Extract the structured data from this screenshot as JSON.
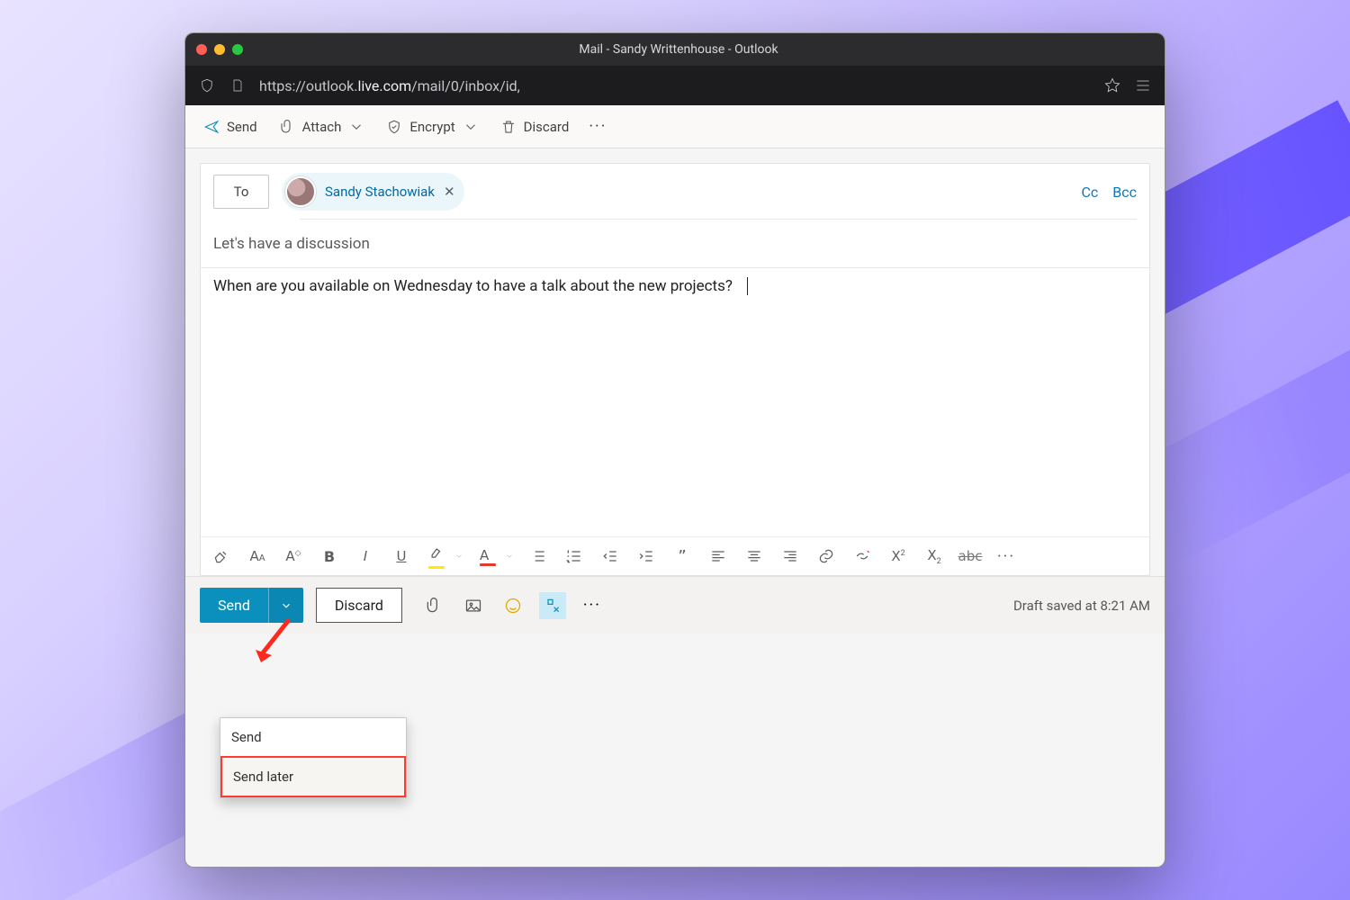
{
  "window": {
    "title": "Mail - Sandy Writtenhouse - Outlook"
  },
  "url": {
    "prefix": "https://outlook.",
    "host": "live.com",
    "path": "/mail/0/inbox/id,"
  },
  "toolbar": {
    "send": "Send",
    "attach": "Attach",
    "encrypt": "Encrypt",
    "discard": "Discard"
  },
  "compose": {
    "to_label": "To",
    "recipient": "Sandy Stachowiak",
    "cc": "Cc",
    "bcc": "Bcc",
    "subject": "Let's have a discussion",
    "body": "When are you available on Wednesday to have a talk about the new projects?"
  },
  "actionbar": {
    "send": "Send",
    "discard": "Discard",
    "draft_status": "Draft saved at 8:21 AM"
  },
  "dropdown": {
    "send": "Send",
    "send_later": "Send later"
  }
}
